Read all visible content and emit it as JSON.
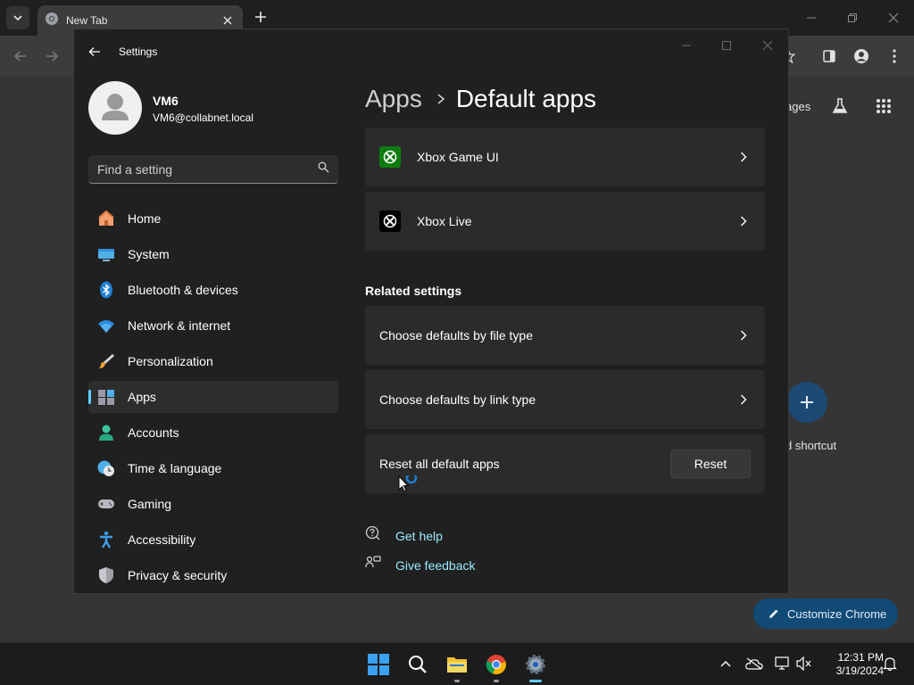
{
  "browser": {
    "tab_title": "New Tab",
    "ntp": {
      "partial_text": "ages",
      "shortcut_label": "d shortcut",
      "customize_label": "Customize Chrome"
    }
  },
  "settings": {
    "window_title": "Settings",
    "user": {
      "name": "VM6",
      "email": "VM6@collabnet.local"
    },
    "search_placeholder": "Find a setting",
    "nav": [
      {
        "label": "Home",
        "icon": "home-icon"
      },
      {
        "label": "System",
        "icon": "system-icon"
      },
      {
        "label": "Bluetooth & devices",
        "icon": "bluetooth-icon"
      },
      {
        "label": "Network & internet",
        "icon": "wifi-icon"
      },
      {
        "label": "Personalization",
        "icon": "paintbrush-icon"
      },
      {
        "label": "Apps",
        "icon": "apps-icon",
        "selected": true
      },
      {
        "label": "Accounts",
        "icon": "accounts-icon"
      },
      {
        "label": "Time & language",
        "icon": "clock-globe-icon"
      },
      {
        "label": "Gaming",
        "icon": "gamepad-icon"
      },
      {
        "label": "Accessibility",
        "icon": "accessibility-icon"
      },
      {
        "label": "Privacy & security",
        "icon": "shield-icon"
      }
    ],
    "breadcrumb": {
      "parent": "Apps",
      "current": "Default apps"
    },
    "apps": [
      {
        "label": "Xbox Game UI",
        "icon": "xbox-icon",
        "color": "#107c10"
      },
      {
        "label": "Xbox Live",
        "icon": "xbox-icon",
        "color": "#000000"
      }
    ],
    "related": {
      "title": "Related settings",
      "file_type": "Choose defaults by file type",
      "link_type": "Choose defaults by link type",
      "reset_label": "Reset all default apps",
      "reset_button": "Reset"
    },
    "help": {
      "get_help": "Get help",
      "give_feedback": "Give feedback"
    }
  },
  "taskbar": {
    "time": "12:31 PM",
    "date": "3/19/2024"
  },
  "colors": {
    "accent": "#60cdff",
    "link": "#99ebff",
    "xbox_green": "#107c10"
  }
}
